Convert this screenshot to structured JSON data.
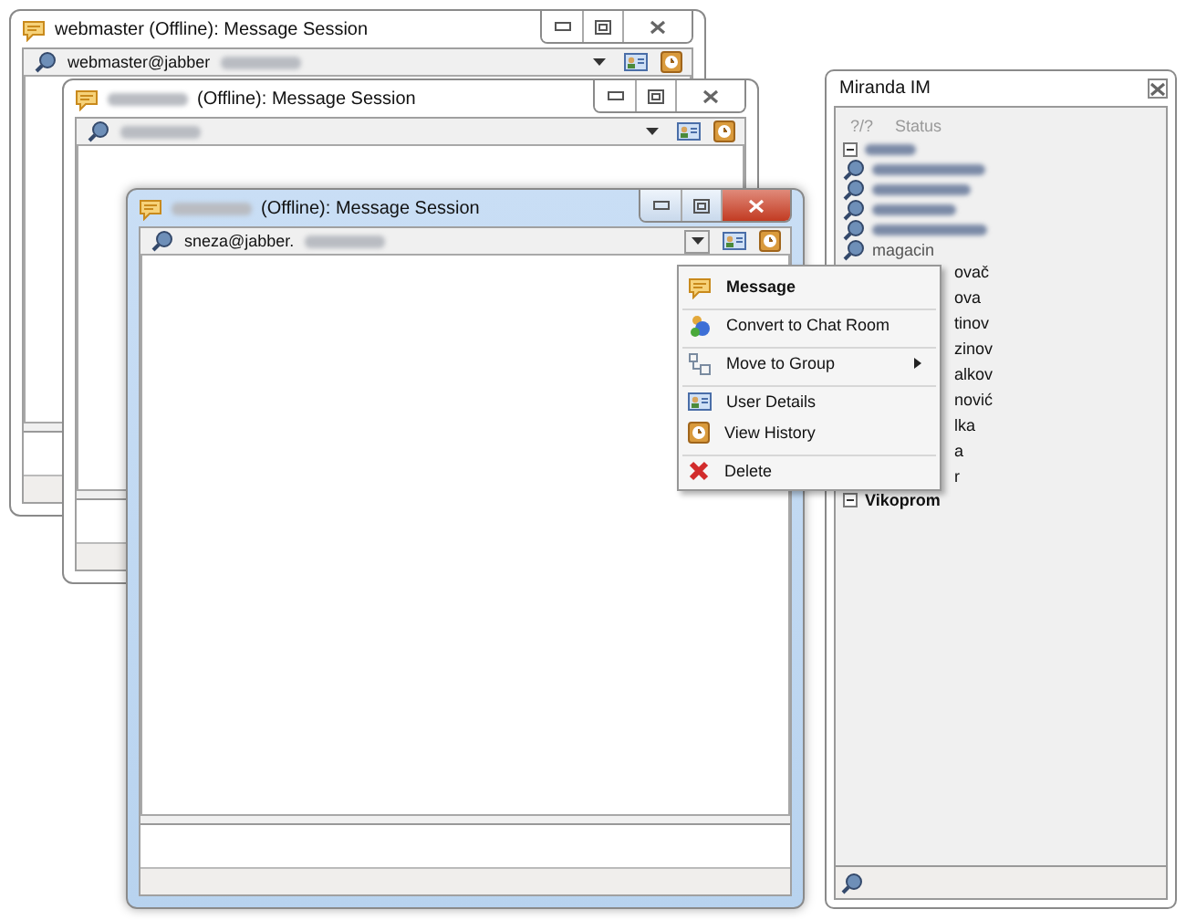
{
  "windows": [
    {
      "title": "webmaster (Offline): Message Session",
      "name_blurred": false,
      "contact": "webmaster@jabber",
      "active": false
    },
    {
      "title": "(Offline): Message Session",
      "name_blurred": true,
      "active": false
    },
    {
      "title": "(Offline): Message Session",
      "name_blurred": true,
      "contact": "sneza@jabber.",
      "active": true
    }
  ],
  "context_menu": {
    "items": [
      {
        "label": "Message",
        "kind": "message",
        "default": true,
        "submenu": false,
        "separator_before": false
      },
      {
        "label": "Convert to Chat Room",
        "kind": "convert",
        "default": false,
        "submenu": false,
        "separator_before": true
      },
      {
        "label": "Move to Group",
        "kind": "group",
        "default": false,
        "submenu": true,
        "separator_before": true
      },
      {
        "label": "User Details",
        "kind": "details",
        "default": false,
        "submenu": false,
        "separator_before": true
      },
      {
        "label": "View History",
        "kind": "history",
        "default": false,
        "submenu": false,
        "separator_before": false
      },
      {
        "label": "Delete",
        "kind": "delete",
        "default": false,
        "submenu": false,
        "separator_before": true
      }
    ]
  },
  "contact_list": {
    "title": "Miranda IM",
    "status_count": "?/?",
    "status_label": "Status",
    "rows": [
      {
        "kind": "group_blurred"
      },
      {
        "kind": "blurred"
      },
      {
        "kind": "blurred"
      },
      {
        "kind": "blurred"
      },
      {
        "kind": "blurred"
      },
      {
        "kind": "contact",
        "name": "magacin"
      },
      {
        "kind": "partial",
        "name": "ovač"
      },
      {
        "kind": "partial",
        "name": "ova"
      },
      {
        "kind": "partial",
        "name": "tinov"
      },
      {
        "kind": "partial",
        "name": "zinov"
      },
      {
        "kind": "partial",
        "name": "alkov"
      },
      {
        "kind": "partial",
        "name": "nović"
      },
      {
        "kind": "partial",
        "name": "lka"
      },
      {
        "kind": "partial",
        "name": "a"
      },
      {
        "kind": "partial",
        "name": "r"
      },
      {
        "kind": "group",
        "name": "Vikoprom"
      }
    ]
  }
}
